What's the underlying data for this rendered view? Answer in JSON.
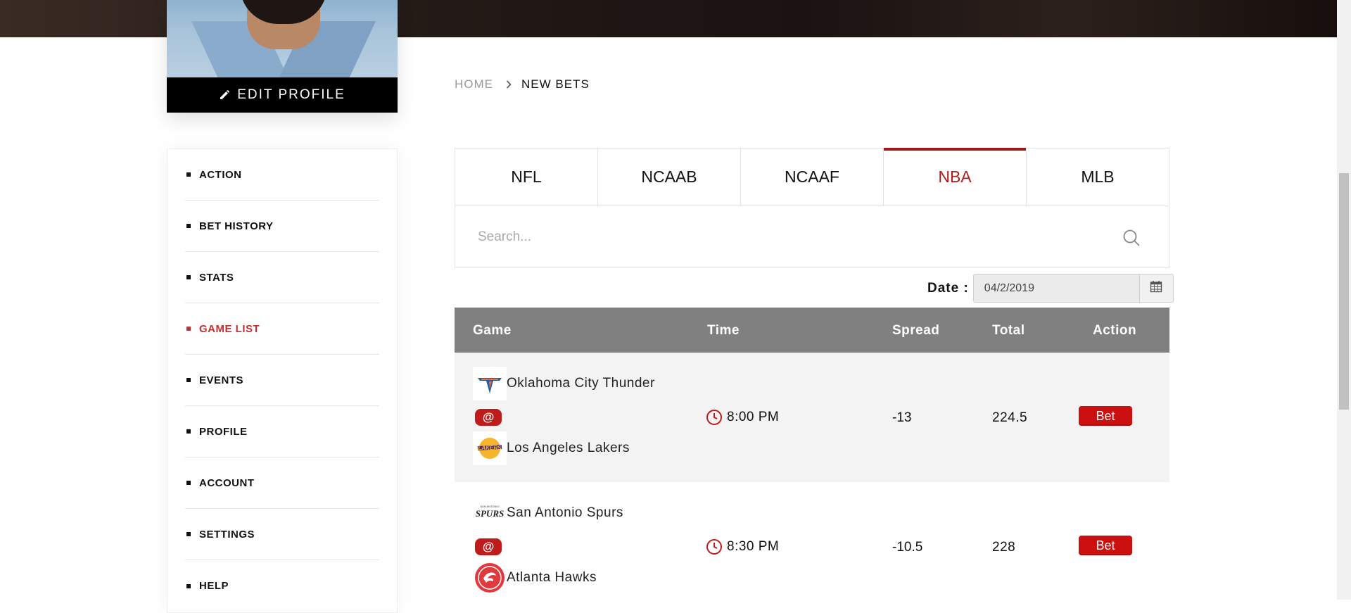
{
  "profile": {
    "edit_label": "EDIT PROFILE"
  },
  "sidebar": {
    "items": [
      {
        "label": "ACTION",
        "active": false
      },
      {
        "label": "BET HISTORY",
        "active": false
      },
      {
        "label": "STATS",
        "active": false
      },
      {
        "label": "GAME LIST",
        "active": true
      },
      {
        "label": "EVENTS",
        "active": false
      },
      {
        "label": "PROFILE",
        "active": false
      },
      {
        "label": "ACCOUNT",
        "active": false
      },
      {
        "label": "SETTINGS",
        "active": false
      },
      {
        "label": "HELP",
        "active": false
      }
    ],
    "active_color": "#c62f2f"
  },
  "breadcrumb": {
    "home": "HOME",
    "current": "NEW BETS"
  },
  "tabs": [
    {
      "label": "NFL",
      "active": false
    },
    {
      "label": "NCAAB",
      "active": false
    },
    {
      "label": "NCAAF",
      "active": false
    },
    {
      "label": "NBA",
      "active": true
    },
    {
      "label": "MLB",
      "active": false
    }
  ],
  "search": {
    "placeholder": "Search...",
    "icon": "search-icon"
  },
  "date": {
    "label": "Date :",
    "value": "04/2/2019",
    "icon": "calendar-icon"
  },
  "table": {
    "headers": {
      "game": "Game",
      "time": "Time",
      "spread": "Spread",
      "total": "Total",
      "action": "Action"
    },
    "rows": [
      {
        "away_team": "Oklahoma City Thunder",
        "home_team": "Los Angeles Lakers",
        "at_symbol": "@",
        "time": "8:00 PM",
        "spread": "-13",
        "total": "224.5",
        "bet_label": "Bet"
      },
      {
        "away_team": "San Antonio Spurs",
        "home_team": "Atlanta Hawks",
        "at_symbol": "@",
        "time": "8:30 PM",
        "spread": "-10.5",
        "total": "228",
        "bet_label": "Bet"
      }
    ]
  },
  "colors": {
    "accent": "#a11818",
    "bet_button": "#cc1010",
    "header_bg": "#808080"
  }
}
